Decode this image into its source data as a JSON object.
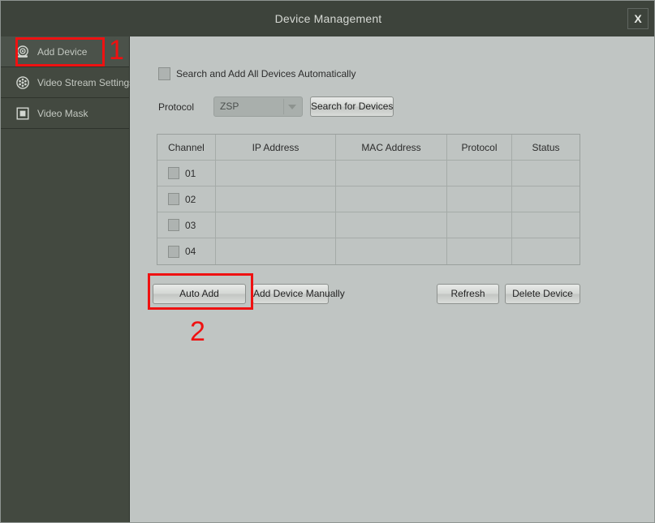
{
  "window": {
    "title": "Device Management",
    "close_label": "X"
  },
  "sidebar": {
    "items": [
      {
        "label": "Add Device",
        "icon": "dome-camera-icon",
        "selected": true
      },
      {
        "label": "Video Stream Settings",
        "icon": "film-reel-icon",
        "selected": false
      },
      {
        "label": "Video Mask",
        "icon": "mask-square-icon",
        "selected": false
      }
    ]
  },
  "main": {
    "auto_search": {
      "label": "Search and Add All Devices Automatically",
      "checked": true
    },
    "protocol": {
      "label": "Protocol",
      "value": "ZSP"
    },
    "search_button": "Search for Devices",
    "table": {
      "headers": [
        "Channel",
        "IP Address",
        "MAC Address",
        "Protocol",
        "Status"
      ],
      "rows": [
        {
          "channel": "01",
          "checked": true,
          "ip": "",
          "mac": "",
          "protocol": "",
          "status": ""
        },
        {
          "channel": "02",
          "checked": false,
          "ip": "",
          "mac": "",
          "protocol": "",
          "status": ""
        },
        {
          "channel": "03",
          "checked": false,
          "ip": "",
          "mac": "",
          "protocol": "",
          "status": ""
        },
        {
          "channel": "04",
          "checked": false,
          "ip": "",
          "mac": "",
          "protocol": "",
          "status": ""
        }
      ]
    },
    "buttons": {
      "auto_add": "Auto Add",
      "add_manually": "Add Device Manually",
      "refresh": "Refresh",
      "delete_device": "Delete Device"
    }
  },
  "annotations": {
    "step_one": "1",
    "step_two": "2",
    "color": "#ef1111"
  }
}
